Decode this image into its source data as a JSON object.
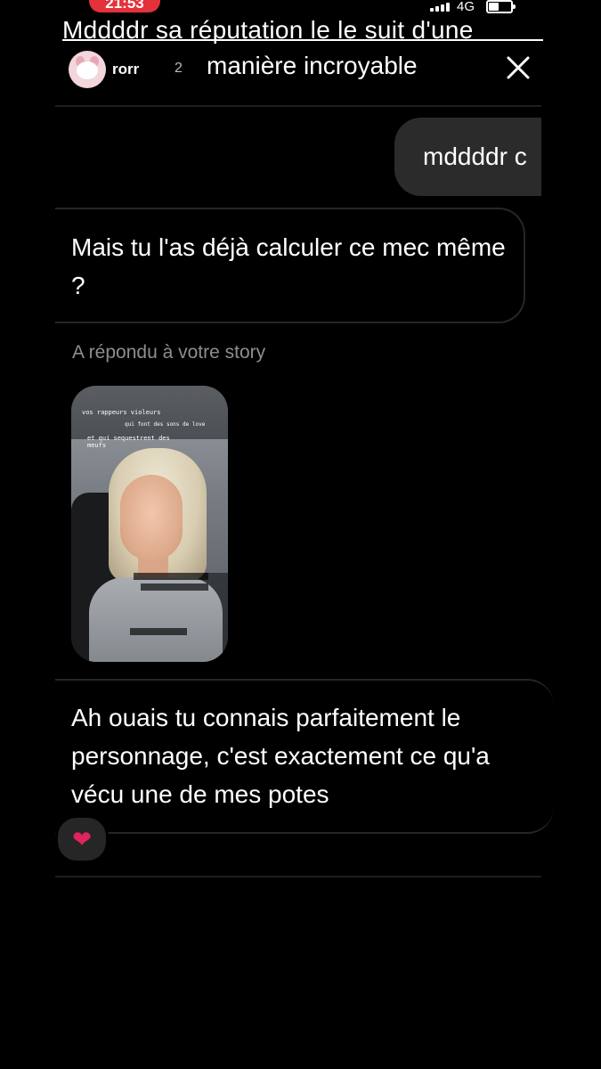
{
  "status_bar": {
    "time": "21:53",
    "network": "4G"
  },
  "overlay": {
    "line1": "Mddddr sa réputation le le suit d'une",
    "line2": "manière incroyable"
  },
  "header": {
    "username": "rorr",
    "time_ago": "2"
  },
  "messages": {
    "sent_1": "mddddr c",
    "received_1": "Mais tu l'as déjà calculer ce mec même ?",
    "story_reply_label": "A répondu à votre story",
    "received_2": "Ah ouais tu connais parfaitement le personnage, c'est exactement ce qu'a vécu une de mes potes",
    "reaction": "❤"
  },
  "story": {
    "caption_1": "vos rappeurs violeurs",
    "caption_2": "qui font des sons de love",
    "caption_3": "et qui sequestrent des meufs"
  }
}
